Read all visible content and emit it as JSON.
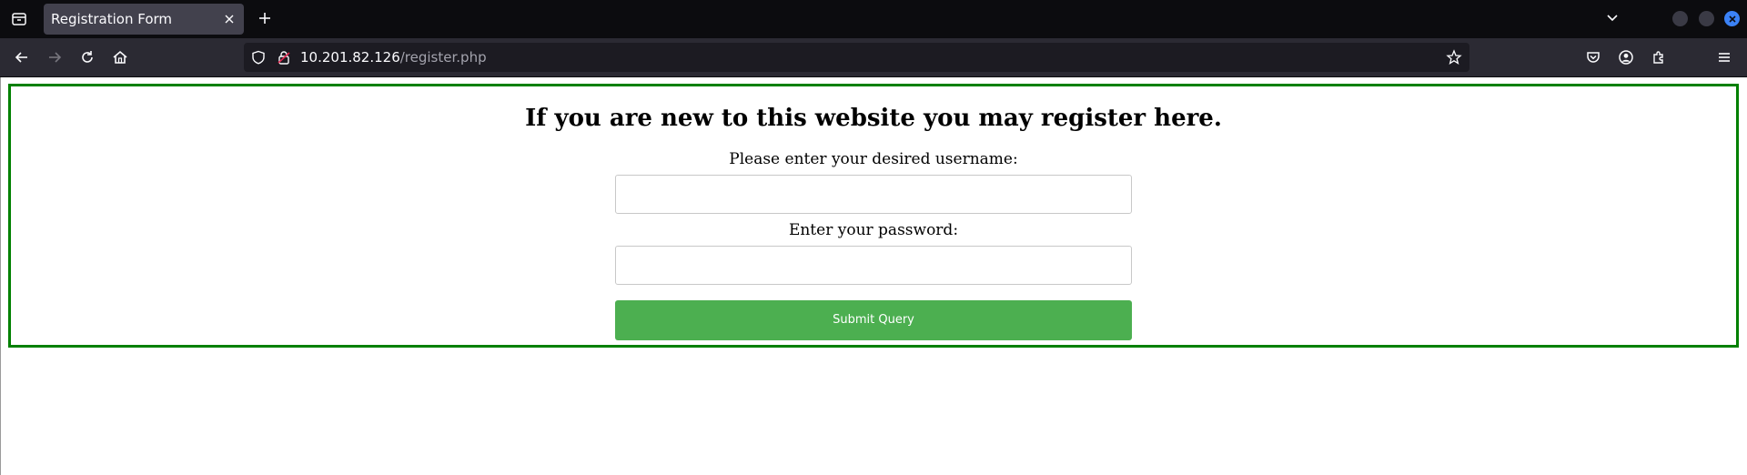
{
  "browser": {
    "tab": {
      "title": "Registration Form"
    },
    "url": {
      "host": "10.201.82.126",
      "path": "/register.php"
    },
    "icons": {
      "tabs_list": "tabs-list-icon",
      "tab_close": "close-icon",
      "new_tab": "plus-icon",
      "tab_overflow": "chevron-down-icon",
      "back": "arrow-left-icon",
      "forward": "arrow-right-icon",
      "reload": "reload-icon",
      "home": "home-icon",
      "tracking_protection": "shield-icon",
      "insecure": "lock-warning-icon",
      "bookmark": "star-icon",
      "pocket": "pocket-icon",
      "account": "account-icon",
      "extensions": "puzzle-icon",
      "menu": "hamburger-icon"
    },
    "colors": {
      "accent_close": "#3b82f6",
      "titlebar": "#0c0c0f",
      "toolbar": "#2b2a33"
    }
  },
  "form": {
    "heading": "If you are new to this website you may register here.",
    "username_label": "Please enter your desired username:",
    "username_value": "",
    "password_label": "Enter your password:",
    "password_value": "",
    "submit_label": "Submit Query",
    "colors": {
      "border": "#008000",
      "button": "#4caf50"
    }
  }
}
